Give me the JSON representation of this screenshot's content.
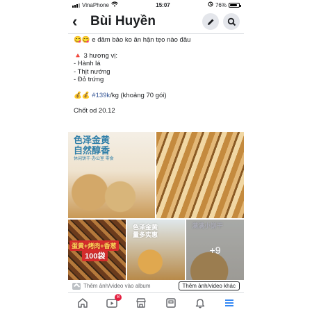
{
  "status": {
    "carrier": "VinaPhone",
    "time": "15:07",
    "battery": "76%"
  },
  "header": {
    "title": "Bùi Huyền"
  },
  "post": {
    "line1": "😋😋  e đảm bảo ko ân hận tẹo nào đâu",
    "line2": "🔺 3 hương vị:",
    "flavors": [
      "- Hành lá",
      "- Thịt nướng",
      "- Đỏ trứng"
    ],
    "price_prefix": "💰💰 ",
    "price_tag": "#139k",
    "price_suffix": "/kg (khoảng 70 gói)",
    "closing": "Chốt od 20.12"
  },
  "images": {
    "img1_text": "色泽金黄\n自然醇香",
    "img1_sub": "休闲饼干·办公室 零食",
    "img3_text1": "蛋黄+烤肉+香葱",
    "img3_text2": "100袋",
    "img4_text": "色泽金黄\n量多实惠",
    "img5_text": "满满小饼干",
    "more_count": "+9"
  },
  "addbar": {
    "label": "Thêm ảnh/video vào album",
    "button": "Thêm ảnh/video khác"
  },
  "tabbar": {
    "video_badge": "8"
  },
  "colors": {
    "accent": "#1877f2",
    "badge": "#e41e3f",
    "text": "#1c1e21"
  }
}
